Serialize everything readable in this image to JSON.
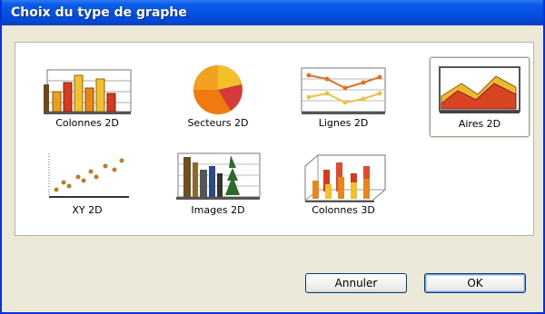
{
  "dialog": {
    "title": "Choix du type de graphe"
  },
  "chart_types": [
    {
      "label": "Colonnes 2D",
      "icon": "bar-2d-icon"
    },
    {
      "label": "Secteurs 2D",
      "icon": "pie-2d-icon"
    },
    {
      "label": "Lignes 2D",
      "icon": "line-2d-icon"
    },
    {
      "label": "Aires 2D",
      "icon": "area-2d-icon",
      "selected": true
    },
    {
      "label": "XY 2D",
      "icon": "scatter-2d-icon"
    },
    {
      "label": "Images 2D",
      "icon": "picture-2d-icon"
    },
    {
      "label": "Colonnes 3D",
      "icon": "bar-3d-icon"
    }
  ],
  "buttons": {
    "cancel": "Annuler",
    "ok": "OK"
  },
  "colors": {
    "title_bar": "#0553e1",
    "selection_border": "#a2a08f",
    "ok_focus": "#7ba2e7"
  }
}
